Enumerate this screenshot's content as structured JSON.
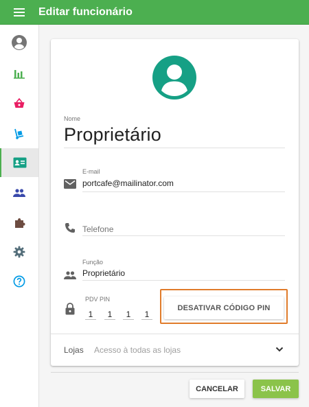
{
  "header": {
    "title": "Editar funcionário",
    "menu_icon": "hamburger-icon",
    "color": "#4caf50"
  },
  "sidebar": {
    "items": [
      {
        "icon": "account-circle-icon",
        "active": false
      },
      {
        "icon": "bar-chart-icon",
        "active": false
      },
      {
        "icon": "basket-icon",
        "active": false
      },
      {
        "icon": "hand-truck-icon",
        "active": false
      },
      {
        "icon": "contact-card-icon",
        "active": true
      },
      {
        "icon": "people-icon",
        "active": false
      },
      {
        "icon": "puzzle-icon",
        "active": false
      },
      {
        "icon": "gear-icon",
        "active": false
      },
      {
        "icon": "help-icon",
        "active": false
      }
    ]
  },
  "form": {
    "avatar_icon": "person-avatar-icon",
    "avatar_color": "#16a085",
    "name": {
      "label": "Nome",
      "value": "Proprietário"
    },
    "email": {
      "label": "E-mail",
      "value": "portcafe@mailinator.com",
      "icon": "email-icon"
    },
    "phone": {
      "placeholder": "Telefone",
      "icon": "phone-icon"
    },
    "role": {
      "label": "Função",
      "value": "Proprietário",
      "icon": "people-icon"
    },
    "pin": {
      "label": "PDV PIN",
      "digits": [
        "1",
        "1",
        "1",
        "1"
      ],
      "icon": "lock-icon",
      "button_label": "DESATIVAR CÓDIGO PIN",
      "highlight_color": "#e07b2a"
    },
    "stores": {
      "label": "Lojas",
      "value": "Acesso à todas as lojas",
      "icon": "chevron-down-icon"
    }
  },
  "actions": {
    "cancel_label": "CANCELAR",
    "save_label": "SALVAR",
    "save_color": "#8bc34a"
  }
}
